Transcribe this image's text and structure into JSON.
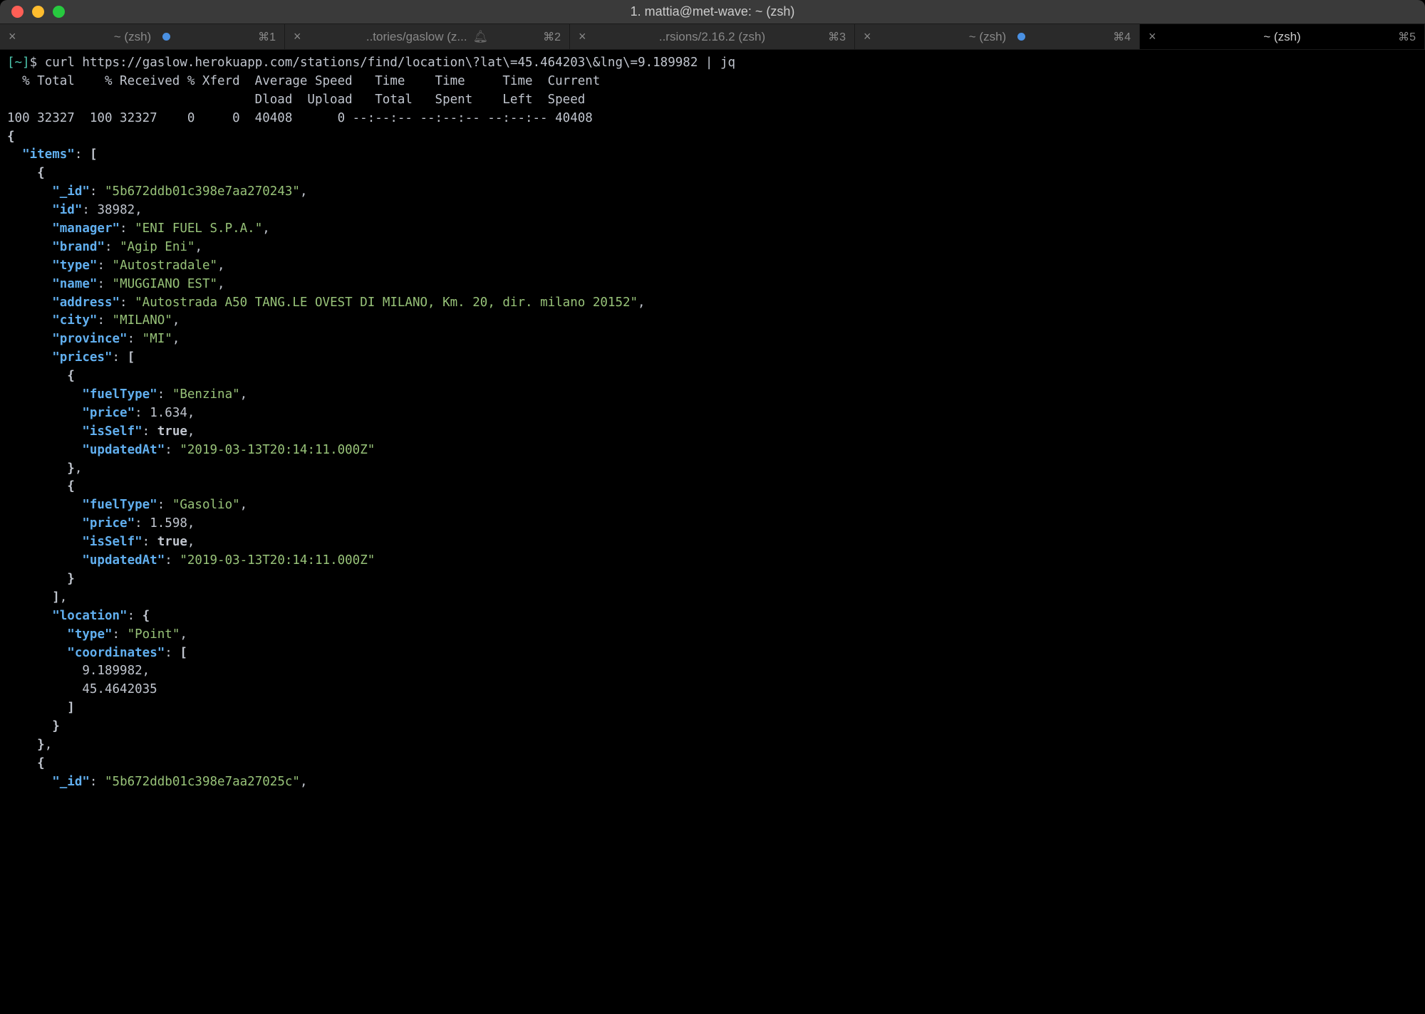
{
  "window": {
    "title": "1. mattia@met-wave: ~ (zsh)"
  },
  "tabs": [
    {
      "label": "~ (zsh)",
      "shortcut": "⌘1",
      "dot": true,
      "close": true,
      "active": false
    },
    {
      "label": "..tories/gaslow (z...",
      "shortcut": "⌘2",
      "bell": true,
      "close": true,
      "active": false
    },
    {
      "label": "..rsions/2.16.2 (zsh)",
      "shortcut": "⌘3",
      "close": true,
      "active": false
    },
    {
      "label": "~ (zsh)",
      "shortcut": "⌘4",
      "dot": true,
      "close": true,
      "active": false
    },
    {
      "label": "~ (zsh)",
      "shortcut": "⌘5",
      "close": true,
      "active": true
    }
  ],
  "prompt": {
    "open": "[",
    "tilde": "~",
    "close": "]",
    "dollar": "$"
  },
  "command": "curl https://gaslow.herokuapp.com/stations/find/location\\?lat\\=45.464203\\&lng\\=9.189982 | jq",
  "curl_output": {
    "header1": "  % Total    % Received % Xferd  Average Speed   Time    Time     Time  Current",
    "header2": "                                 Dload  Upload   Total   Spent    Left  Speed",
    "stats": "100 32327  100 32327    0     0  40408      0 --:--:-- --:--:-- --:--:-- 40408"
  },
  "json": {
    "items_key": "\"items\"",
    "item1": {
      "_id_key": "\"_id\"",
      "_id_val": "\"5b672ddb01c398e7aa270243\"",
      "id_key": "\"id\"",
      "id_val": "38982",
      "manager_key": "\"manager\"",
      "manager_val": "\"ENI FUEL S.P.A.\"",
      "brand_key": "\"brand\"",
      "brand_val": "\"Agip Eni\"",
      "type_key": "\"type\"",
      "type_val": "\"Autostradale\"",
      "name_key": "\"name\"",
      "name_val": "\"MUGGIANO EST\"",
      "address_key": "\"address\"",
      "address_val": "\"Autostrada A50 TANG.LE OVEST DI MILANO, Km. 20, dir. milano 20152\"",
      "city_key": "\"city\"",
      "city_val": "\"MILANO\"",
      "province_key": "\"province\"",
      "province_val": "\"MI\"",
      "prices_key": "\"prices\"",
      "price1": {
        "fuelType_key": "\"fuelType\"",
        "fuelType_val": "\"Benzina\"",
        "price_key": "\"price\"",
        "price_val": "1.634",
        "isSelf_key": "\"isSelf\"",
        "isSelf_val": "true",
        "updatedAt_key": "\"updatedAt\"",
        "updatedAt_val": "\"2019-03-13T20:14:11.000Z\""
      },
      "price2": {
        "fuelType_key": "\"fuelType\"",
        "fuelType_val": "\"Gasolio\"",
        "price_key": "\"price\"",
        "price_val": "1.598",
        "isSelf_key": "\"isSelf\"",
        "isSelf_val": "true",
        "updatedAt_key": "\"updatedAt\"",
        "updatedAt_val": "\"2019-03-13T20:14:11.000Z\""
      },
      "location_key": "\"location\"",
      "loc_type_key": "\"type\"",
      "loc_type_val": "\"Point\"",
      "coordinates_key": "\"coordinates\"",
      "coord1": "9.189982",
      "coord2": "45.4642035"
    },
    "item2": {
      "_id_key": "\"_id\"",
      "_id_val": "\"5b672ddb01c398e7aa27025c\""
    }
  }
}
